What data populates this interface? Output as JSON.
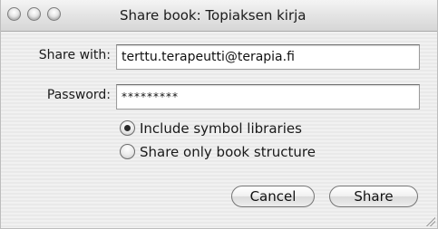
{
  "window": {
    "title": "Share book: Topiaksen kirja"
  },
  "form": {
    "share_with_label": "Share with:",
    "share_with_value": "terttu.terapeutti@terapia.fi",
    "password_label": "Password:",
    "password_value": "*********"
  },
  "options": [
    {
      "label": "Include symbol libraries",
      "selected": true
    },
    {
      "label": "Share only book structure",
      "selected": false
    }
  ],
  "buttons": {
    "cancel": "Cancel",
    "share": "Share"
  }
}
